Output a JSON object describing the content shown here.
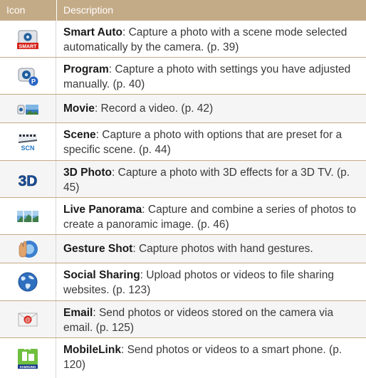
{
  "header": {
    "icon_col": "Icon",
    "desc_col": "Description"
  },
  "rows": [
    {
      "icon": "smart-auto-icon",
      "name": "Smart Auto",
      "desc": ": Capture a photo with a scene mode selected automatically by the camera. (p. 39)",
      "icon_label": "SMART"
    },
    {
      "icon": "program-icon",
      "name": "Program",
      "desc": ": Capture a photo with settings you have adjusted manually. (p. 40)",
      "icon_label": "P"
    },
    {
      "icon": "movie-icon",
      "name": "Movie",
      "desc": ": Record a video. (p. 42)"
    },
    {
      "icon": "scene-icon",
      "name": "Scene",
      "desc": ": Capture a photo with options that are preset for a specific scene. (p. 44)",
      "icon_label": "SCN"
    },
    {
      "icon": "3d-photo-icon",
      "name": "3D Photo",
      "desc": ": Capture a photo with 3D effects for a 3D TV. (p. 45)",
      "icon_label": "3D"
    },
    {
      "icon": "live-panorama-icon",
      "name": "Live Panorama",
      "desc": ": Capture and combine a series of photos to create a panoramic image. (p. 46)"
    },
    {
      "icon": "gesture-shot-icon",
      "name": "Gesture Shot",
      "desc": ": Capture photos with hand gestures."
    },
    {
      "icon": "social-sharing-icon",
      "name": "Social Sharing",
      "desc": ": Upload photos or videos to file sharing websites. (p. 123)"
    },
    {
      "icon": "email-icon",
      "name": "Email",
      "desc": ": Send photos or videos stored on the camera via email. (p. 125)"
    },
    {
      "icon": "mobilelink-icon",
      "name": "MobileLink",
      "desc": ": Send photos or videos to a smart phone. (p. 120)",
      "icon_label": "SAMSUNG"
    }
  ],
  "colors": {
    "header_bg": "#c4ab87",
    "row_border": "#c4ab87",
    "shaded_row": "#f5f5f5",
    "text": "#3a3a3a"
  }
}
